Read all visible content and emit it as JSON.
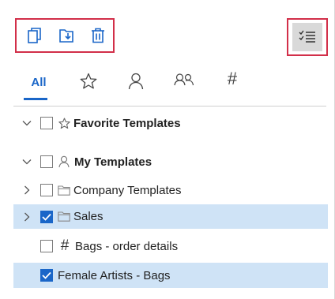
{
  "toolbar": {
    "copy_icon": "copy-icon",
    "import_icon": "import-icon",
    "delete_icon": "trash-icon",
    "view_toggle_icon": "checklist-icon"
  },
  "tabs": [
    {
      "label": "All",
      "active": true
    },
    {
      "icon": "star-icon"
    },
    {
      "icon": "person-icon"
    },
    {
      "icon": "people-icon"
    },
    {
      "icon": "hash-icon",
      "glyph": "#"
    }
  ],
  "tree": {
    "favorites": {
      "label": "Favorite Templates",
      "expanded": true,
      "checked": false
    },
    "my_templates": {
      "label": "My Templates",
      "expanded": true,
      "checked": false
    },
    "company_templates": {
      "label": "Company Templates",
      "expanded": false,
      "checked": false
    },
    "sales": {
      "label": "Sales",
      "expanded": false,
      "checked": true,
      "selected": true
    },
    "bags_order": {
      "label": "Bags - order details",
      "glyph": "#",
      "checked": false
    },
    "female_artists": {
      "label": "Female Artists - Bags",
      "checked": true,
      "selected": true
    }
  },
  "colors": {
    "accent": "#1a66c8",
    "highlight": "#d22f49",
    "selected_row": "#cfe3f6"
  }
}
